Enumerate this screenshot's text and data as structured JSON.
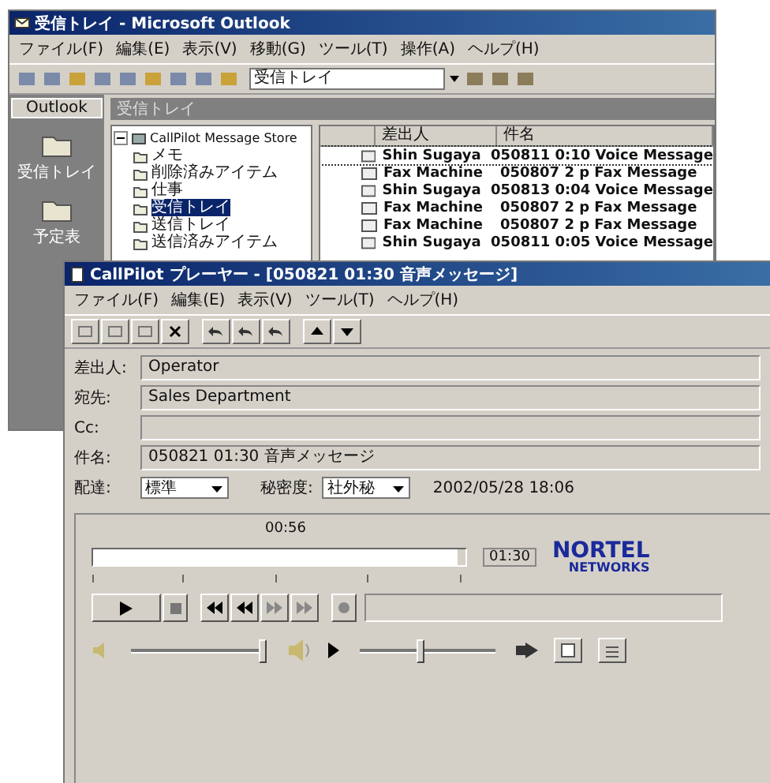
{
  "outlook": {
    "title": "受信トレイ - Microsoft Outlook",
    "menu": [
      "ファイル(F)",
      "編集(E)",
      "表示(V)",
      "移動(G)",
      "ツール(T)",
      "操作(A)",
      "ヘルプ(H)"
    ],
    "address": "受信トレイ",
    "shortcut_bar": {
      "header": "Outlook",
      "items": [
        {
          "label": "受信トレイ"
        },
        {
          "label": "予定表"
        }
      ]
    },
    "folder_title": "受信トレイ",
    "tree": {
      "label": "CallPilot Message Store",
      "expanded": true,
      "children": [
        {
          "label": "メモ",
          "selected": false
        },
        {
          "label": "削除済みアイテム",
          "selected": false
        },
        {
          "label": "仕事",
          "selected": false
        },
        {
          "label": "受信トレイ",
          "selected": true
        },
        {
          "label": "送信トレイ",
          "selected": false
        },
        {
          "label": "送信済みアイテム",
          "selected": false
        }
      ]
    },
    "columns": [
      "差出人",
      "件名"
    ],
    "rows": [
      {
        "from": "Shin Sugaya",
        "subject": "050811 0:10 Voice Message",
        "selected": true
      },
      {
        "from": "Fax Machine",
        "subject": "050807 2 p Fax Message",
        "selected": false
      },
      {
        "from": "Shin Sugaya",
        "subject": "050813 0:04 Voice Message",
        "selected": false
      },
      {
        "from": "Fax Machine",
        "subject": "050807 2 p Fax Message",
        "selected": false
      },
      {
        "from": "Fax Machine",
        "subject": "050807 2 p Fax Message",
        "selected": false
      },
      {
        "from": "Shin Sugaya",
        "subject": "050811 0:05 Voice Message",
        "selected": false
      }
    ]
  },
  "player": {
    "title": "CallPilot プレーヤー - [050821 01:30 音声メッセージ]",
    "menu": [
      "ファイル(F)",
      "編集(E)",
      "表示(V)",
      "ツール(T)",
      "ヘルプ(H)"
    ],
    "fields": [
      {
        "label": "差出人:",
        "value": "Operator"
      },
      {
        "label": "宛先:",
        "value": "Sales Department"
      },
      {
        "label": "Cc:"
      },
      {
        "label": "件名:",
        "value": "050821 01:30 音声メッセージ"
      }
    ],
    "delivery": {
      "label": "配達:",
      "value": "標準"
    },
    "sensitivity": {
      "label": "秘密度:",
      "value": "社外秘"
    },
    "date": "2002/05/28 18:06",
    "position": "00:56",
    "progress": {
      "level": 0.98
    },
    "duration": "01:30",
    "logo": {
      "line1": "NORTEL",
      "line2": "NETWORKS"
    },
    "volume": {
      "level": 0.97
    },
    "speed": {
      "level": 0.45
    }
  }
}
